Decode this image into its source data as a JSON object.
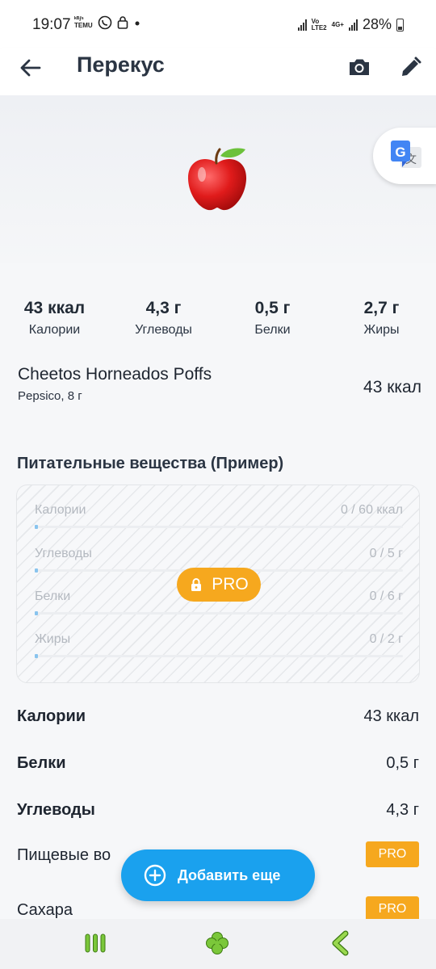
{
  "status_bar": {
    "time": "19:07",
    "mini_label_1": "ᵏᴮ/ˢ",
    "mini_label_2": "TEMU",
    "net_label_1": "Vo",
    "net_label_2": "LTE2",
    "net_label_3": "4G+",
    "battery": "28%"
  },
  "header": {
    "title": "Перекус"
  },
  "macros": [
    {
      "value": "43 ккал",
      "label": "Калории"
    },
    {
      "value": "4,3 г",
      "label": "Углеводы"
    },
    {
      "value": "0,5 г",
      "label": "Белки"
    },
    {
      "value": "2,7 г",
      "label": "Жиры"
    }
  ],
  "product": {
    "name": "Cheetos Horneados Poffs",
    "subtitle": "Pepsico, 8 г",
    "kcal": "43 ккал"
  },
  "nutrients": {
    "title": "Питательные вещества (Пример)",
    "rows": [
      {
        "label": "Калории",
        "value": "0 / 60 ккал",
        "progress": 0
      },
      {
        "label": "Углеводы",
        "value": "0 / 5 г",
        "progress": 0
      },
      {
        "label": "Белки",
        "value": "0 / 6 г",
        "progress": 0
      },
      {
        "label": "Жиры",
        "value": "0 / 2 г",
        "progress": 0
      }
    ],
    "pro_label": "PRO"
  },
  "details": [
    {
      "label": "Калории",
      "value": "43 ккал"
    },
    {
      "label": "Белки",
      "value": "0,5 г"
    },
    {
      "label": "Углеводы",
      "value": "4,3 г"
    },
    {
      "label": "Пищевые во",
      "badge": "PRO"
    },
    {
      "label": "Сахара",
      "badge": "PRO"
    }
  ],
  "fab": {
    "label": "Добавить еще"
  },
  "colors": {
    "accent_blue": "#1aa1ee",
    "pro_orange": "#f6a81e",
    "nav_green": "#7bc73a"
  }
}
